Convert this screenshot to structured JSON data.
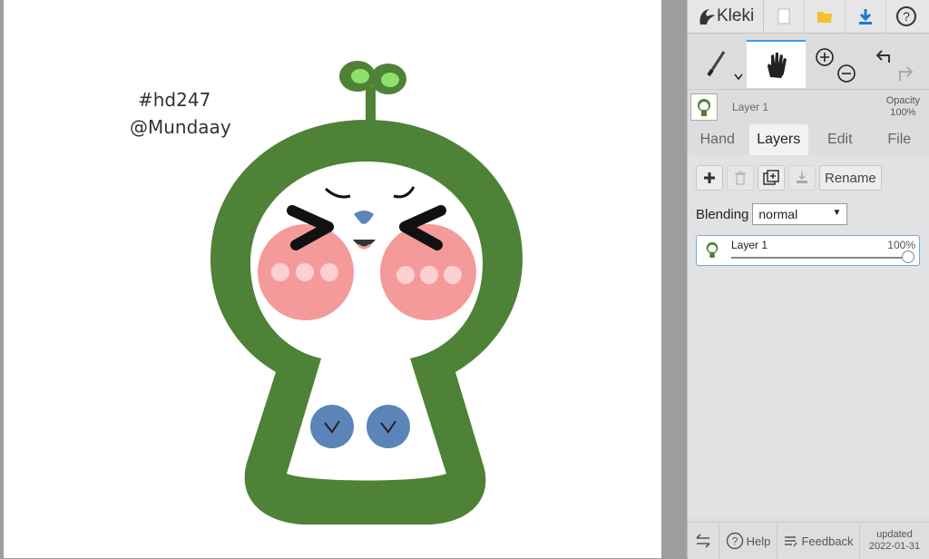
{
  "app": {
    "name": "Kleki"
  },
  "canvas": {
    "handwritten_line1": "#hd247",
    "handwritten_line2": "@Mundaay"
  },
  "toolbar": {
    "icons": [
      "new-image-icon",
      "open-folder-icon",
      "download-icon",
      "help-icon"
    ]
  },
  "layer_info": {
    "name": "Layer 1",
    "opacity_label": "Opacity",
    "opacity_value": "100%"
  },
  "tabs": [
    {
      "label": "Hand",
      "active": false
    },
    {
      "label": "Layers",
      "active": true
    },
    {
      "label": "Edit",
      "active": false
    },
    {
      "label": "File",
      "active": false
    }
  ],
  "layers_panel": {
    "rename_label": "Rename",
    "blending_label": "Blending",
    "blending_value": "normal",
    "layers": [
      {
        "name": "Layer 1",
        "opacity": "100%",
        "opacity_fraction": 1.0
      }
    ]
  },
  "footer": {
    "help_label": "Help",
    "feedback_label": "Feedback",
    "updated_label": "updated",
    "updated_date": "2022-01-31"
  },
  "colors": {
    "green": "#4e8237",
    "cheek": "#f59a9a",
    "blue": "#5b84b8",
    "accent": "#3b9be8"
  }
}
